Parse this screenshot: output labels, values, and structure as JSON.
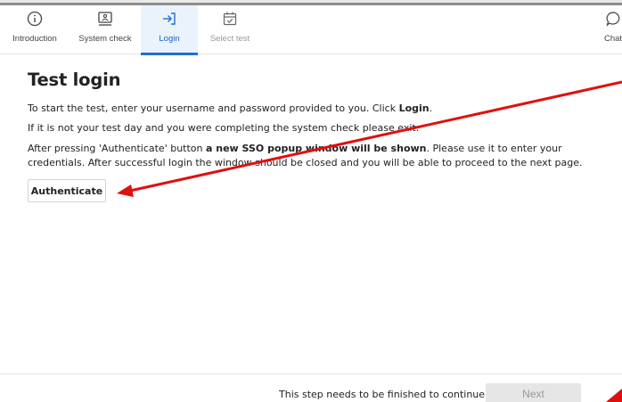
{
  "steps": [
    {
      "label": "Introduction",
      "icon": "info-icon",
      "state": "done"
    },
    {
      "label": "System check",
      "icon": "computer-check-icon",
      "state": "done"
    },
    {
      "label": "Login",
      "icon": "login-arrow-icon",
      "state": "active"
    },
    {
      "label": "Select test",
      "icon": "calendar-check-icon",
      "state": "disabled"
    },
    {
      "label": "Chat",
      "icon": "chat-bubble-icon",
      "state": "available"
    }
  ],
  "page": {
    "title": "Test login",
    "p1_before": "To start the test, enter your username and password provided to you. Click ",
    "p1_bold": "Login",
    "p1_after": ".",
    "p2": "If it is not your test day and you were completing the system check please exit.",
    "p3_before": "After pressing 'Authenticate' button ",
    "p3_bold": "a new SSO popup window will be shown",
    "p3_after": ". Please use it to enter your credentials. After successful login the window should be closed and you will be able to proceed to the next page.",
    "authenticate_label": "Authenticate"
  },
  "footer": {
    "message": "This step needs to be finished to continue.",
    "next_label": "Next"
  },
  "colors": {
    "accent": "#1e6fd0",
    "active_tab_bg": "#eaf3fc",
    "annotation_arrow": "#e01010"
  }
}
